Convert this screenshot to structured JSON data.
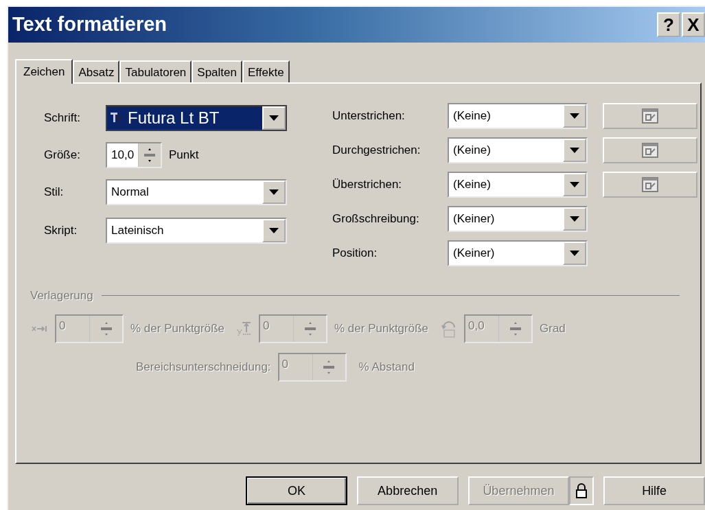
{
  "window": {
    "title": "Text formatieren",
    "help_button": "?",
    "close_button": "X"
  },
  "tabs": [
    {
      "label": "Zeichen",
      "selected": true
    },
    {
      "label": "Absatz",
      "selected": false
    },
    {
      "label": "Tabulatoren",
      "selected": false
    },
    {
      "label": "Spalten",
      "selected": false
    },
    {
      "label": "Effekte",
      "selected": false
    }
  ],
  "left_fields": [
    {
      "label": "Schrift:",
      "kind": "font",
      "value": "Futura Lt BT"
    },
    {
      "label": "Größe:",
      "kind": "spin",
      "value": "10,0",
      "unit": "Punkt"
    },
    {
      "label": "Stil:",
      "kind": "combo",
      "value": "Normal"
    },
    {
      "label": "Skript:",
      "kind": "combo",
      "value": "Lateinisch"
    }
  ],
  "right_fields": [
    {
      "label": "Unterstrichen:",
      "value": "(Keine)",
      "has_settings": true
    },
    {
      "label": "Durchgestrichen:",
      "value": "(Keine)",
      "has_settings": true
    },
    {
      "label": "Überstrichen:",
      "value": "(Keine)",
      "has_settings": true
    },
    {
      "label": "Großschreibung:",
      "value": "(Keiner)",
      "has_settings": false
    },
    {
      "label": "Position:",
      "value": "(Keiner)",
      "has_settings": false
    }
  ],
  "displacement": {
    "title": "Verlagerung",
    "disabled": true,
    "fields": [
      {
        "kind": "horizontal",
        "value": "0",
        "unit": "% der Punktgröße"
      },
      {
        "kind": "vertical",
        "value": "0",
        "unit": "% der Punktgröße"
      },
      {
        "kind": "rotation",
        "value": "0,0",
        "unit": "Grad"
      }
    ],
    "spacing": {
      "label": "Bereichsunterschneidung:",
      "value": "0",
      "unit": "% Abstand"
    }
  },
  "buttons": [
    {
      "kind": "button",
      "label": "OK",
      "default": true,
      "disabled": false
    },
    {
      "kind": "button",
      "label": "Abbrechen",
      "default": false,
      "disabled": false
    },
    {
      "kind": "button",
      "label": "Übernehmen",
      "default": false,
      "disabled": true
    },
    {
      "kind": "lock"
    },
    {
      "kind": "button",
      "label": "Hilfe",
      "default": false,
      "disabled": false
    }
  ]
}
